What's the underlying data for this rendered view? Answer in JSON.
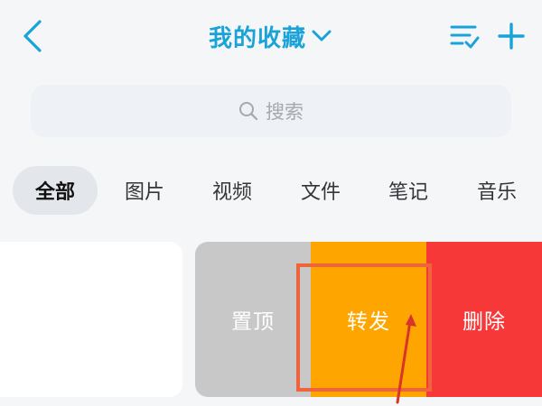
{
  "header": {
    "title": "我的收藏",
    "icons": {
      "back": "chevron-left-icon",
      "title_caret": "chevron-down-icon",
      "multi_select": "list-check-icon",
      "add": "plus-icon"
    }
  },
  "search": {
    "placeholder": "搜索",
    "icon": "search-icon"
  },
  "tabs": [
    {
      "label": "全部",
      "active": true
    },
    {
      "label": "图片",
      "active": false
    },
    {
      "label": "视频",
      "active": false
    },
    {
      "label": "文件",
      "active": false
    },
    {
      "label": "笔记",
      "active": false
    },
    {
      "label": "音乐",
      "active": false
    }
  ],
  "swipe_actions": {
    "pin": "置顶",
    "forward": "转发",
    "delete": "删除"
  },
  "colors": {
    "accent": "#1aa3d8",
    "pin_bg": "#c8c8c8",
    "forward_bg": "#ffa500",
    "delete_bg": "#f73838",
    "annotation": "#f0643c"
  }
}
